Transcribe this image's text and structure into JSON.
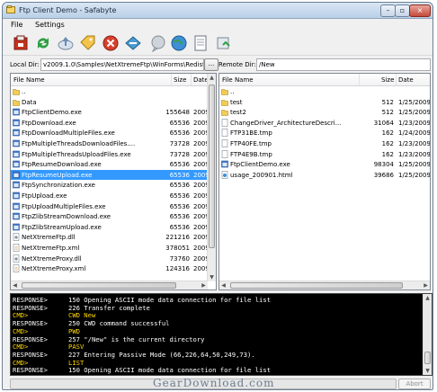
{
  "window": {
    "title": "Ftp Client Demo - Safabyte"
  },
  "menu": [
    "File",
    "Settings"
  ],
  "toolbar": {
    "icons": [
      "connect-icon",
      "refresh-icon",
      "upload-icon",
      "label-icon",
      "stop-icon",
      "transfer-icon",
      "bubble-icon",
      "globe-icon",
      "page-icon",
      "sync-icon"
    ]
  },
  "local": {
    "label": "Local Dir:",
    "path": "v2009.1.0\\Samples\\NetXtremeFtp\\WinForms\\Redist\\",
    "browse": "...",
    "columns": {
      "name": "File Name",
      "size": "Size",
      "date": "Date"
    },
    "files": [
      {
        "name": "..",
        "size": "",
        "date": "",
        "type": "folder"
      },
      {
        "name": "Data",
        "size": "",
        "date": "",
        "type": "folder"
      },
      {
        "name": "FtpClientDemo.exe",
        "size": "155648",
        "date": "2009",
        "type": "exe"
      },
      {
        "name": "FtpDownload.exe",
        "size": "65536",
        "date": "2009",
        "type": "exe"
      },
      {
        "name": "FtpDownloadMultipleFiles.exe",
        "size": "65536",
        "date": "2009",
        "type": "exe"
      },
      {
        "name": "FtpMultipleThreadsDownloadFiles....",
        "size": "73728",
        "date": "2009",
        "type": "exe"
      },
      {
        "name": "FtpMultipleThreadsUploadFiles.exe",
        "size": "73728",
        "date": "2009",
        "type": "exe"
      },
      {
        "name": "FtpResumeDownload.exe",
        "size": "65536",
        "date": "2009",
        "type": "exe"
      },
      {
        "name": "FtpResumeUpload.exe",
        "size": "65536",
        "date": "2009",
        "type": "exe",
        "selected": true
      },
      {
        "name": "FtpSynchronization.exe",
        "size": "65536",
        "date": "2009",
        "type": "exe"
      },
      {
        "name": "FtpUpload.exe",
        "size": "65536",
        "date": "2009",
        "type": "exe"
      },
      {
        "name": "FtpUploadMultipleFiles.exe",
        "size": "65536",
        "date": "2009",
        "type": "exe"
      },
      {
        "name": "FtpZlibStreamDownload.exe",
        "size": "65536",
        "date": "2009",
        "type": "exe"
      },
      {
        "name": "FtpZlibStreamUpload.exe",
        "size": "65536",
        "date": "2009",
        "type": "exe"
      },
      {
        "name": "NetXtremeFtp.dll",
        "size": "221216",
        "date": "2009",
        "type": "dll"
      },
      {
        "name": "NetXtremeFtp.xml",
        "size": "378051",
        "date": "2009",
        "type": "xml"
      },
      {
        "name": "NetXtremeProxy.dll",
        "size": "73760",
        "date": "2009",
        "type": "dll"
      },
      {
        "name": "NetXtremeProxy.xml",
        "size": "124316",
        "date": "2009",
        "type": "xml"
      }
    ]
  },
  "remote": {
    "label": "Remote Dir:",
    "path": "/New",
    "columns": {
      "name": "File Name",
      "size": "Size",
      "date": "Date"
    },
    "files": [
      {
        "name": "..",
        "size": "",
        "date": "",
        "type": "folder"
      },
      {
        "name": "test",
        "size": "512",
        "date": "1/25/2009",
        "type": "folder"
      },
      {
        "name": "test2",
        "size": "512",
        "date": "1/25/2009",
        "type": "folder"
      },
      {
        "name": "ChangeDriver_ArchitectureDescri...",
        "size": "31064",
        "date": "1/23/2009",
        "type": "file"
      },
      {
        "name": "FTP31BE.tmp",
        "size": "162",
        "date": "1/24/2009",
        "type": "file"
      },
      {
        "name": "FTP40FE.tmp",
        "size": "162",
        "date": "1/23/2009",
        "type": "file"
      },
      {
        "name": "FTP4E9B.tmp",
        "size": "162",
        "date": "1/23/2009",
        "type": "file"
      },
      {
        "name": "FtpClientDemo.exe",
        "size": "98304",
        "date": "1/25/2009",
        "type": "exe"
      },
      {
        "name": "usage_200901.html",
        "size": "39686",
        "date": "1/25/2009",
        "type": "html"
      }
    ]
  },
  "log": [
    {
      "prefix": "RESPONSE>",
      "text": "150 Opening ASCII mode data connection for file list",
      "kind": "resp"
    },
    {
      "prefix": "RESPONSE>",
      "text": "226 Transfer complete",
      "kind": "resp"
    },
    {
      "prefix": "CMD>",
      "text": "CWD New",
      "kind": "cmd"
    },
    {
      "prefix": "RESPONSE>",
      "text": "250 CWD command successful",
      "kind": "resp"
    },
    {
      "prefix": "CMD>",
      "text": "PWD",
      "kind": "cmd"
    },
    {
      "prefix": "RESPONSE>",
      "text": "257 \"/New\" is the current directory",
      "kind": "resp"
    },
    {
      "prefix": "CMD>",
      "text": "PASV",
      "kind": "cmd"
    },
    {
      "prefix": "RESPONSE>",
      "text": "227 Entering Passive Mode (66,226,64,50,249,73).",
      "kind": "resp"
    },
    {
      "prefix": "CMD>",
      "text": "LIST",
      "kind": "cmd"
    },
    {
      "prefix": "RESPONSE>",
      "text": "150 Opening ASCII mode data connection for file list",
      "kind": "resp"
    }
  ],
  "status": {
    "progress": 0,
    "abort_label": "Abort"
  },
  "watermark": "GearDownload.com"
}
